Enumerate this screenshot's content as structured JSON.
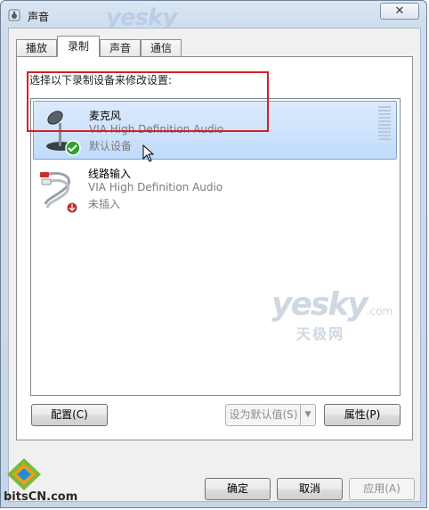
{
  "window": {
    "title": "声音",
    "close_glyph": "✕",
    "watermark_top": "yesky"
  },
  "tabs": [
    {
      "label": "播放",
      "active": false
    },
    {
      "label": "录制",
      "active": true
    },
    {
      "label": "声音",
      "active": false
    },
    {
      "label": "通信",
      "active": false
    }
  ],
  "instruction": "选择以下录制设备来修改设置:",
  "devices": [
    {
      "name": "麦克风",
      "driver": "VIA High Definition Audio",
      "status": "默认设备",
      "icon": "microphone-icon",
      "badge": "default-check-icon",
      "selected": true
    },
    {
      "name": "线路输入",
      "driver": "VIA High Definition Audio",
      "status": "未插入",
      "icon": "rca-cable-icon",
      "badge": "unplugged-icon",
      "selected": false
    }
  ],
  "watermark": {
    "main": "yesky",
    "suffix": ".com",
    "sub": "天极网"
  },
  "buttons": {
    "configure": "配置(C)",
    "set_default": "设为默认值(S)",
    "properties": "属性(P)",
    "ok": "确定",
    "cancel": "取消",
    "apply": "应用(A)"
  },
  "logo": {
    "text": "bitsCN.com"
  },
  "colors": {
    "selection": "#c1dbfc",
    "highlight_box": "#d61f26",
    "default_badge": "#2ea12e"
  }
}
